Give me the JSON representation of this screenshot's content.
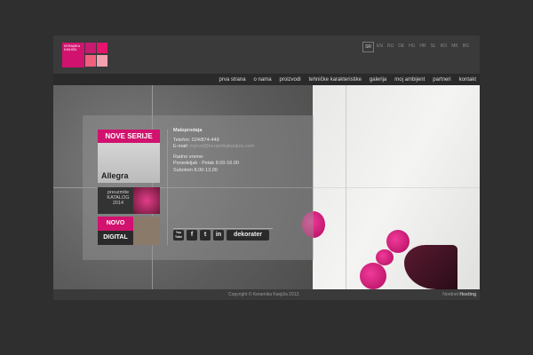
{
  "logo": {
    "text": "KERAMIKA KANJIŽA",
    "colors": [
      "#d1126e",
      "#c81a70",
      "#e8136b",
      "#f0607e",
      "#f4a0b0"
    ]
  },
  "languages": [
    "SR",
    "EN",
    "RU",
    "DE",
    "HU",
    "HR",
    "SL",
    "RO",
    "MK",
    "BG"
  ],
  "active_language": "SR",
  "nav": [
    "prva strana",
    "o nama",
    "proizvodi",
    "tehničke karakteristike",
    "galerija",
    "moj ambijent",
    "partneri",
    "kontakt"
  ],
  "promos": {
    "nove_serije": "NOVE SERIJE",
    "allegra": "Allegra",
    "katalog_line1": "preuzmite",
    "katalog_line2": "KATALOG",
    "katalog_year": "2014",
    "novo": "NOVO",
    "digital": "DIGITAL"
  },
  "contact": {
    "heading": "Maloprodaja",
    "phone": "Telefon: 024/874-449",
    "email_label": "E-mail:",
    "email": "mprod@keramikakanjiza.com",
    "hours_label": "Radno vreme:",
    "weekdays": "Ponedeljak - Petak 8.00-16.00",
    "saturday": "Subotom 8.00-13.00"
  },
  "social": {
    "youtube": "You Tube",
    "facebook": "f",
    "twitter": "t",
    "linkedin": "in",
    "dekorater": "dekorater"
  },
  "footer": {
    "copyright": "Copyright © Keramika Kanjiža 2012.",
    "hosting_prefix": "Nordnet",
    "hosting": "Hosting"
  }
}
